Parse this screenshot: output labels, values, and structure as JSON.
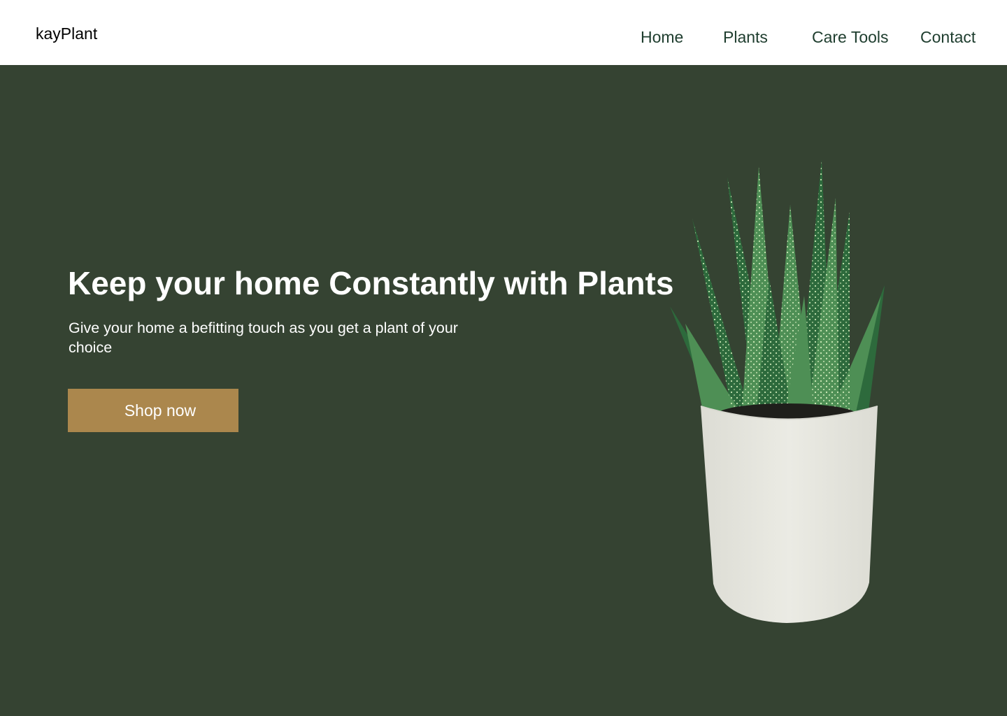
{
  "brand": {
    "name": "kayPlant"
  },
  "nav": {
    "items": [
      {
        "label": "Home"
      },
      {
        "label": "Plants"
      },
      {
        "label": "Care Tools"
      },
      {
        "label": "Contact"
      }
    ]
  },
  "hero": {
    "headline": "Keep your home Constantly with Plants",
    "subtext": "Give your home a befitting touch as you get a plant of your choice",
    "cta_label": "Shop now",
    "image_icon": "potted-succulent-icon"
  },
  "colors": {
    "header_bg": "#ffffff",
    "hero_bg": "#354332",
    "nav_text": "#1e3d2e",
    "cta_bg": "#ab874d",
    "pot": "#ebebe4",
    "leaf_dark": "#2d6a3c",
    "leaf_light": "#4e8f55",
    "leaf_spots": "#c9e6b4"
  }
}
